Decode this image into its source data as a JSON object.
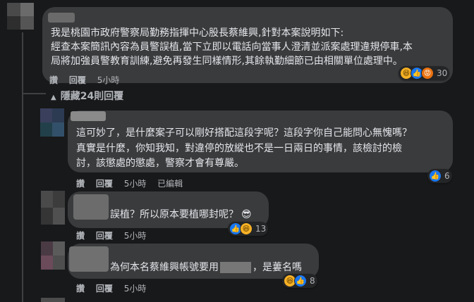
{
  "comments": [
    {
      "text_lines": [
        "我是桃園市政府警察局勤務指揮中心股長蔡維興,針對本案說明如下:",
        "經查本案簡訊內容為員警誤植,當下立即以電話向當事人澄清並派案處理違規停車,本",
        "局將加強員警教育訓練,避免再發生同樣情形,其餘執勤細節已由相關單位處理中。"
      ],
      "actions": {
        "like": "讚",
        "reply": "回覆",
        "time": "5小時"
      },
      "reactions": {
        "icons": [
          "haha-icon",
          "like-icon",
          "angry-icon"
        ],
        "count": "30"
      }
    },
    {
      "text_lines": [
        "這可妙了，是什麼案子可以剛好搭配這段字呢？這段字你自己能問心無愧嗎？",
        "真實是什麼，你知我知，對違停的放縱也不是一日兩日的事情，該檢討的檢",
        "討，該懲處的懲處，警察才會有尊嚴。"
      ],
      "actions": {
        "like": "讚",
        "reply": "回覆",
        "time": "5小時",
        "edited": "已編輯"
      },
      "reactions": {
        "icons": [
          "like-icon"
        ],
        "count": "6"
      }
    },
    {
      "text_lines": [
        "誤植？所以原本要植哪封呢？"
      ],
      "emoji": "😎",
      "actions": {
        "like": "讚",
        "reply": "回覆",
        "time": "5小時"
      },
      "reactions": {
        "icons": [
          "like-icon",
          "haha-icon"
        ],
        "count": "13"
      }
    },
    {
      "text_before": "為何本名蔡維興帳號要用",
      "text_after": "，是蔞名嗎",
      "actions": {
        "like": "讚",
        "reply": "回覆",
        "time": "5小時"
      },
      "reactions": {
        "icons": [
          "haha-icon",
          "like-icon"
        ],
        "count": "8"
      }
    }
  ],
  "hide_replies": {
    "icon": "chevron-up-icon",
    "label": "隱藏24則回覆"
  },
  "colors": {
    "background": "#18191a",
    "bubble": "#3a3b3c",
    "text": "#e4e6eb",
    "secondary": "#b0b3b8",
    "like_blue": "#1877f2"
  }
}
